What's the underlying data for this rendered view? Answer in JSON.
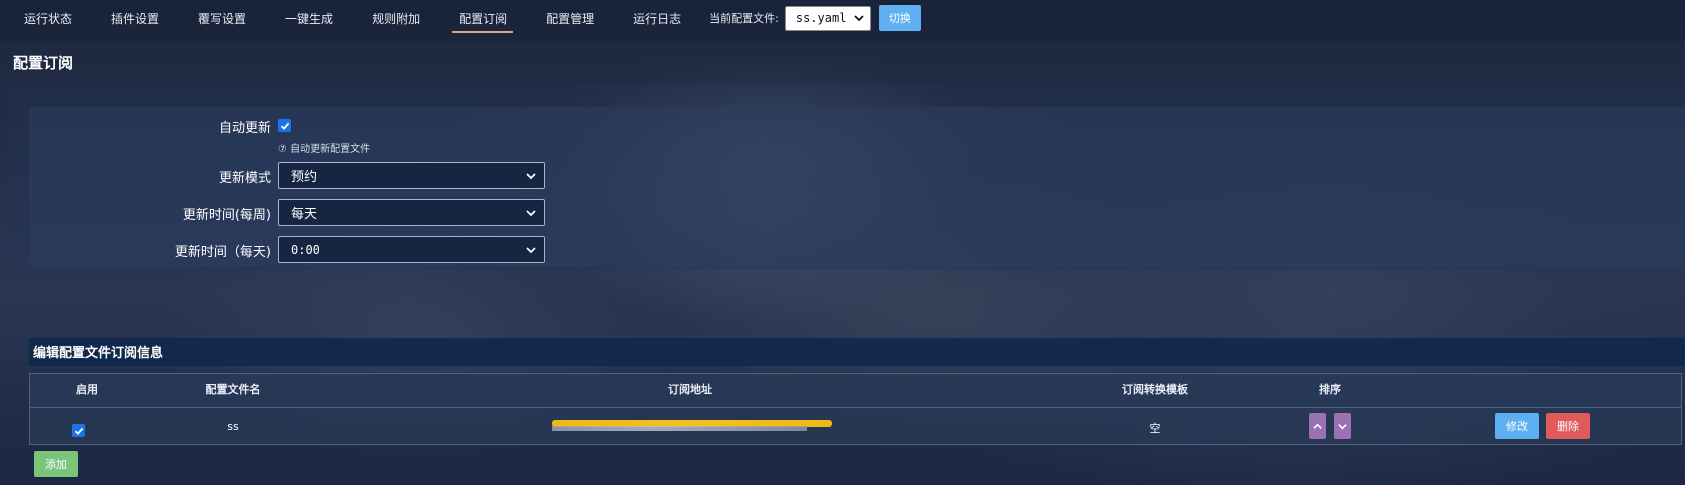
{
  "nav": {
    "items": [
      "运行状态",
      "插件设置",
      "覆写设置",
      "一键生成",
      "规则附加",
      "配置订阅",
      "配置管理",
      "运行日志"
    ],
    "active_index": 5,
    "current_config_label": "当前配置文件:",
    "current_config_value": "ss.yaml",
    "switch_label": "切换"
  },
  "section": {
    "title": "配置订阅"
  },
  "form": {
    "auto_update_label": "自动更新",
    "auto_update_checked": true,
    "auto_update_help": "自动更新配置文件",
    "update_mode_label": "更新模式",
    "update_mode_value": "预约",
    "update_week_label": "更新时间(每周)",
    "update_week_value": "每天",
    "update_day_label": "更新时间（每天)",
    "update_day_value": "0:00"
  },
  "subscription": {
    "title": "编辑配置文件订阅信息",
    "headers": [
      "启用",
      "配置文件名",
      "订阅地址",
      "订阅转换模板",
      "排序"
    ],
    "rows": [
      {
        "enabled": true,
        "name": "ss",
        "template": "空"
      }
    ],
    "edit_label": "修改",
    "delete_label": "删除",
    "add_label": "添加"
  },
  "colors": {
    "nav_bg": "#1a243a",
    "active_underline": "#e8a08c",
    "primary_button": "#5fb0f0",
    "danger_button": "#e05a5a",
    "success_button": "#7cc47c",
    "sort_button": "#9a72b4",
    "checkbox": "#1a73e8"
  }
}
